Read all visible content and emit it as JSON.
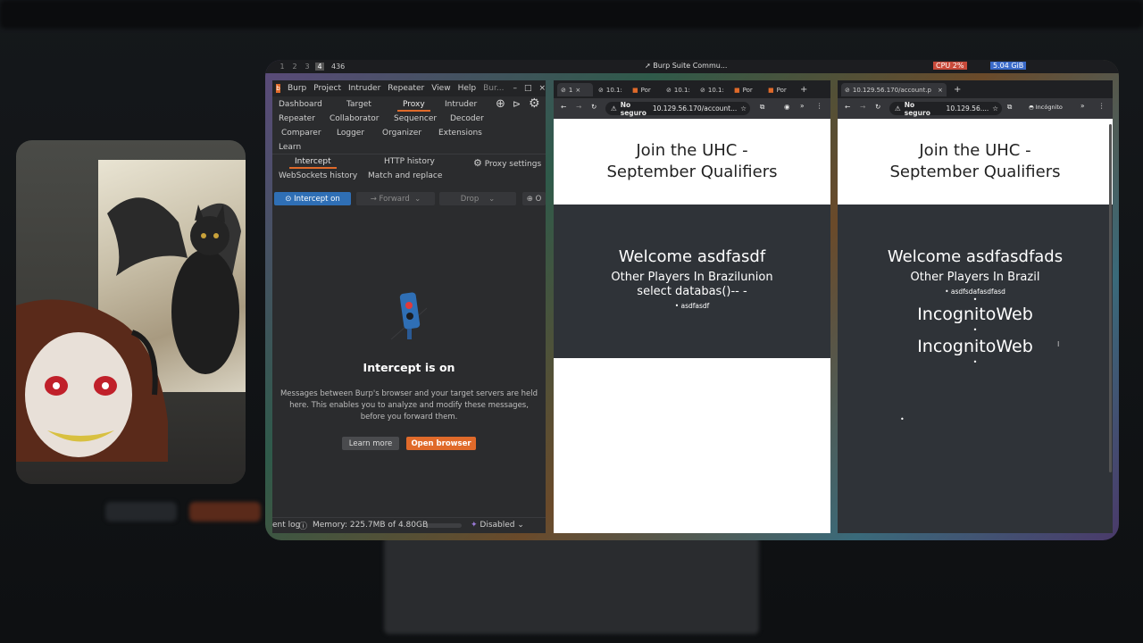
{
  "topbar": {
    "workspaces": [
      "1",
      "2",
      "3",
      "4"
    ],
    "counter": "436",
    "title": "Burp Suite Commu...",
    "cpu": "CPU 2%",
    "mem": "5.04 GiB"
  },
  "burp": {
    "menu": [
      "Burp",
      "Project",
      "Intruder",
      "Repeater",
      "View",
      "Help",
      "Bur..."
    ],
    "tabs": {
      "dashboard": "Dashboard",
      "target": "Target",
      "proxy": "Proxy",
      "intruder": "Intruder",
      "repeater": "Repeater",
      "collaborator": "Collaborator",
      "sequencer": "Sequencer",
      "decoder": "Decoder",
      "comparer": "Comparer",
      "logger": "Logger",
      "organizer": "Organizer",
      "extensions": "Extensions",
      "learn": "Learn"
    },
    "subtabs": {
      "intercept": "Intercept",
      "http_history": "HTTP history",
      "proxy_settings": "Proxy settings",
      "websockets": "WebSockets history",
      "match_replace": "Match and replace"
    },
    "toolbar": {
      "intercept_on": "Intercept on",
      "forward": "Forward",
      "drop": "Drop",
      "open": "O"
    },
    "panel": {
      "heading": "Intercept is on",
      "description": "Messages between Burp's browser and your target servers are held here. This enables you to analyze and modify these messages, before you forward them.",
      "learn_more": "Learn more",
      "open_browser": "Open browser"
    },
    "status": {
      "log": "ent log",
      "memory": "Memory: 225.7MB of 4.80GB",
      "memory_fraction": 0.047,
      "disabled": "Disabled"
    }
  },
  "browser1": {
    "tabs": [
      "1",
      "10.1:",
      "Por",
      "10.1:",
      "10.1:",
      "Por",
      "Por"
    ],
    "security": "No seguro",
    "url": "10.129.56.170/account...",
    "hero_line1": "Join the UHC -",
    "hero_line2": "September Qualifiers",
    "welcome": "Welcome asdfasdf",
    "players_line1": "Other Players In Brazilunion",
    "players_line2": "select databas()-- -",
    "list_item": "asdfasdf"
  },
  "browser2": {
    "tab": "10.129.56.170/account.p",
    "security": "No seguro",
    "url": "10.129.56....",
    "incognito": "Incógnito",
    "hero_line1": "Join the UHC -",
    "hero_line2": "September Qualifiers",
    "welcome": "Welcome asdfasdfads",
    "players": "Other Players In Brazil",
    "list_item": "asdfsdafasdfasd",
    "incog1": "IncognitoWeb",
    "incog2": "IncognitoWeb",
    "cursor": "I"
  },
  "colors": {
    "burp_orange": "#e06a2a",
    "burp_bg": "#2b2c2e",
    "intercept_blue": "#2f6fb5",
    "dark_section": "#2f3338"
  }
}
